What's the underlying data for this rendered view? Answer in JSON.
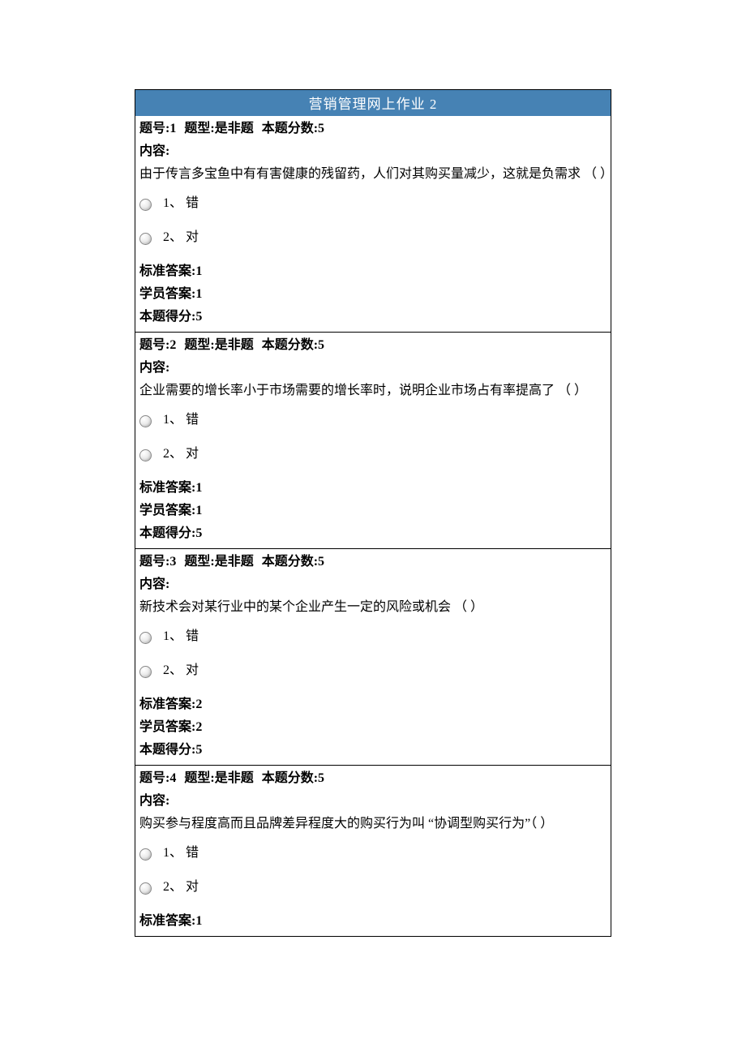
{
  "title": "营销管理网上作业 2",
  "labels": {
    "num_prefix": "题号:",
    "type_prefix": "题型:",
    "score_prefix": "本题分数:",
    "content_label": "内容:",
    "std_answer_prefix": "标准答案:",
    "stu_answer_prefix": "学员答案:",
    "got_score_prefix": "本题得分:"
  },
  "questions": [
    {
      "num": "1",
      "type": "是非题",
      "score": "5",
      "content": "由于传言多宝鱼中有有害健康的残留药，人们对其购买量减少，这就是负需求 （ ）",
      "choices": [
        "1、  错",
        "2、  对"
      ],
      "std_answer": "1",
      "stu_answer": "1",
      "got_score": "5"
    },
    {
      "num": "2",
      "type": "是非题",
      "score": "5",
      "content": "企业需要的增长率小于市场需要的增长率时，说明企业市场占有率提高了 （ ）",
      "choices": [
        "1、  错",
        "2、  对"
      ],
      "std_answer": "1",
      "stu_answer": "1",
      "got_score": "5"
    },
    {
      "num": "3",
      "type": "是非题",
      "score": "5",
      "content": "新技术会对某行业中的某个企业产生一定的风险或机会 （ ）",
      "choices": [
        "1、  错",
        "2、  对"
      ],
      "std_answer": "2",
      "stu_answer": "2",
      "got_score": "5"
    },
    {
      "num": "4",
      "type": "是非题",
      "score": "5",
      "content": "购买参与程度高而且品牌差异程度大的购买行为叫 “协调型购买行为”（ ）",
      "choices": [
        "1、  错",
        "2、  对"
      ],
      "std_answer": "1",
      "stu_answer": null,
      "got_score": null
    }
  ]
}
